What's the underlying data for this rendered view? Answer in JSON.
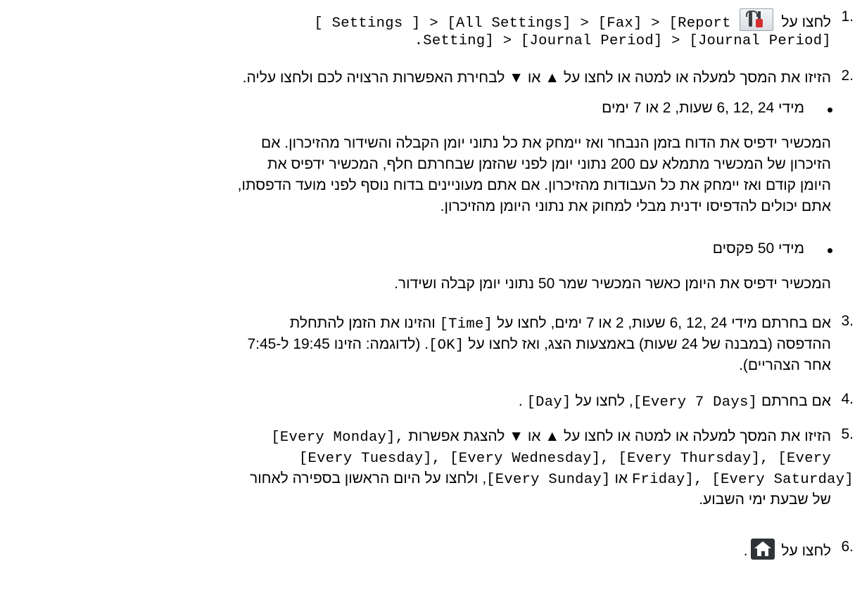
{
  "steps": [
    {
      "number": "1.",
      "lines": [
        {
          "pre": "לחצו על",
          "icon": "settings-icon",
          "mono": "[ Settings ] > [All Settings] > [Fax] > [Report"
        },
        {
          "mono": "Setting] > [Journal Period] > [Journal Period]",
          "post": "."
        }
      ]
    },
    {
      "number": "2.",
      "text": "הזיזו את המסך למעלה או למטה או לחצו על ▲ או ▼ לבחירת האפשרות הרצויה לכם ולחצו עליה.",
      "options": [
        {
          "bullet": "מידי 24 ,12 ,6 שעות, 2 או 7 ימים",
          "paragraph": [
            "המכשיר ידפיס את הדוח בזמן הנבחר ואז יימחק את כל נתוני יומן הקבלה והשידור מהזיכרון. אם",
            "הזיכרון של המכשיר מתמלא עם 200 נתוני יומן לפני שהזמן שבחרתם חלף, המכשיר ידפיס את",
            "היומן קודם ואז יימחק את כל העבודות מהזיכרון. אם אתם מעוניינים בדוח נוסף לפני מועד הדפסתו,",
            "אתם יכולים להדפיסו ידנית מבלי למחוק את נתוני היומן מהזיכרון."
          ]
        },
        {
          "bullet": "מידי 50 פקסים",
          "paragraph": [
            "המכשיר ידפיס את היומן כאשר המכשיר שמר 50 נתוני יומן קבלה ושידור."
          ]
        }
      ]
    },
    {
      "number": "3.",
      "line1_pre": "אם בחרתם מידי 24 ,12 ,6 שעות, 2 או 7 ימים, לחצו על",
      "line1_mono": "[Time]",
      "line1_post": "והזינו את הזמן להתחלת",
      "line2_pre": "ההדפסה (במבנה של 24 שעות) באמצעות הצג, ואז לחצו על",
      "line2_mono": "[OK]",
      "line2_post": ". (לדוגמה:  הזינו 19:45 ל-7:45",
      "line3": "אחר הצהריים)."
    },
    {
      "number": "4.",
      "pre": "אם בחרתם",
      "mono1": "[Every 7 Days]",
      "mid": ", לחצו על",
      "mono2": "[Day]",
      "post": "."
    },
    {
      "number": "5.",
      "line1_pre": "הזיזו את המסך למעלה או למטה או לחצו על ▲ או ▼ להצגת אפשרות",
      "line1_mono": "[Every Monday],",
      "line2_mono": "[Every Tuesday], [Every Wednesday], [Every Thursday], [Every",
      "line3_mono_a": "Friday], [Every Saturday]",
      "line3_or": "או",
      "line3_mono_b": "[Every Sunday]",
      "line3_post": ", ולחצו על היום הראשון בספירה לאחור",
      "line4": "של שבעת ימי השבוע."
    },
    {
      "number": "6.",
      "pre": "לחצו על",
      "icon": "home-icon",
      "post": "."
    }
  ]
}
